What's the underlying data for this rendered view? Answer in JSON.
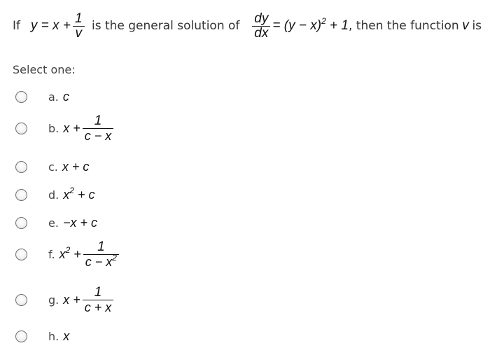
{
  "question": {
    "prefix": "If",
    "solution_lhs": "y = x +",
    "solution_frac_num": "1",
    "solution_frac_den": "v",
    "middle_text": "is the general solution of",
    "ode_frac_num": "dy",
    "ode_frac_den": "dx",
    "ode_rhs_pre": "= (y − x)",
    "ode_rhs_exp": "2",
    "ode_rhs_post": "+ 1",
    "suffix_pre": ", then the function",
    "suffix_var": "v",
    "suffix_post": "is"
  },
  "prompt": "Select one:",
  "options": [
    {
      "letter": "a.",
      "pre": "c",
      "selected": false
    },
    {
      "letter": "b.",
      "pre": "x +",
      "num": "1",
      "den": "c − x",
      "selected": false
    },
    {
      "letter": "c.",
      "pre": "x + c",
      "selected": false
    },
    {
      "letter": "d.",
      "pre": "x",
      "exp": "2",
      "post": " + c",
      "selected": false
    },
    {
      "letter": "e.",
      "pre": "−x + c",
      "selected": false
    },
    {
      "letter": "f.",
      "pre": "x",
      "exp": "2",
      "post": " +",
      "num": "1",
      "den_pre": "c − x",
      "den_exp": "2",
      "selected": false
    },
    {
      "letter": "g.",
      "pre": "x +",
      "num": "1",
      "den": "c + x",
      "selected": false
    },
    {
      "letter": "h.",
      "pre": "x",
      "selected": false
    }
  ]
}
